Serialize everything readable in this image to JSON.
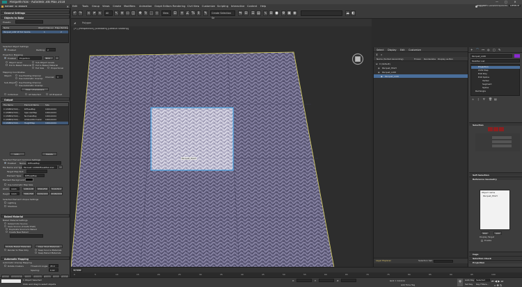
{
  "app": {
    "title": "ParquetF.max - Autodesk 3ds Max 2018",
    "window_controls": [
      "—",
      "□",
      "✕"
    ]
  },
  "menubar": {
    "items": [
      "Edit",
      "Tools",
      "Group",
      "Views",
      "Create",
      "Modifiers",
      "Animation",
      "Graph Editors",
      "Rendering",
      "Civil View",
      "Customize",
      "Scripting",
      "Interactive",
      "Content",
      "Help"
    ],
    "user": "Asggatm Co...",
    "workspace_label": "Workspaces:",
    "workspace": "Default"
  },
  "toolbar": {
    "view_select": "View",
    "selection_set": "Create Selection Se",
    "filter": "All",
    "icons": [
      "undo-icon",
      "redo-icon",
      "link-icon",
      "unlink-icon",
      "bind-icon",
      "select-icon",
      "select-by-name-icon",
      "region-icon",
      "window-crossing-icon",
      "move-icon",
      "rotate-icon",
      "scale-icon",
      "placement-icon",
      "pivot-icon",
      "snap-icon",
      "angle-snap-icon",
      "percent-snap-icon",
      "spinner-snap-icon",
      "edit-named-sets-icon",
      "mirror-icon",
      "align-icon",
      "layer-explorer-icon",
      "toggle-ribbon-icon",
      "curve-editor-icon",
      "schematic-icon",
      "material-editor-icon",
      "render-setup-icon",
      "rendered-frame-icon",
      "render-icon"
    ]
  },
  "subbar": {
    "label": "Polygon"
  },
  "rtt": {
    "title": "Render To Texture",
    "rollouts": {
      "general": "General Settings",
      "objects": "Objects to Bake",
      "output": "Output",
      "baked_material": "Baked Material",
      "auto_map": "Automatic Mapping"
    },
    "preset_label": "Presets:",
    "objects_table": {
      "headers": [
        "Name",
        "Object Channel",
        "Edge Padding"
      ],
      "rows": [
        [
          "Parquet_LOW 1E 8.0 Vanilla",
          "1",
          "2"
        ]
      ]
    },
    "selected_obj_settings": "Selected Object Settings",
    "enabled": "Enabled",
    "padding_label": "Padding:",
    "padding_value": "2",
    "projection_mapping": "Projection Mapping",
    "projection_enabled": "Enabled",
    "projection_mod": "Projection",
    "pick_btn": "Pick...",
    "object_level": "Object Level",
    "sub_object_levels": "Sub-Object Levels",
    "put_to_baked": "Put to Baked Material",
    "put_to_baked2": "Put to Baked Material",
    "full_size": "Full Size",
    "proportional": "Proportional",
    "mapping_coords": "Mapping Coordinates",
    "object_label": "Object:",
    "use_auto_unwrap": "Use Automatic Unwrap",
    "use_existing": "Use Existing Channel",
    "sub_objects_label": "Sub-Objects:",
    "channel_label": "Channel:",
    "channel_value": "3",
    "clear_unwrapper": "Clear Unwrappers",
    "individual": "Individual",
    "all_selected": "All Selected",
    "all_prepared": "All Prepared",
    "output_table": {
      "headers": [
        "File Name",
        "Element Name",
        "Size"
      ],
      "rows": [
        [
          "C:\\USERS\\YOU\\...",
          "DiffuseMap",
          "1024x1024"
        ],
        [
          "C:\\USERS\\YOU\\...",
          "SpecularMap",
          "1024x1024"
        ],
        [
          "C:\\USERS\\YOU\\...",
          "NormalsMap",
          "1024x1024"
        ],
        [
          "C:\\USERS\\YOU\\...",
          "AmbientOcclusion",
          "1024x1024"
        ],
        [
          "C:\\USERS\\YOU\\...",
          "HeightMap",
          "1024x1024"
        ]
      ]
    },
    "add_btn": "Add...",
    "delete_btn": "Delete",
    "selected_element_common": "Selected Element Common Settings",
    "name_label": "Name:",
    "name_value": "DiffuseMap",
    "file_name_type": "File Name and Type:",
    "file_value": "Parquet_LOWDiffuseMap.png",
    "target_map_slot": "Target Map Slot:",
    "element_type": "Element Type:",
    "element_type_value": "DiffuseMap",
    "element_background": "Element Background:",
    "use_auto_map_size": "Use Automatic Map Size",
    "width_label": "Width:",
    "width_value": "1024",
    "height_label": "Height:",
    "height_value": "1024",
    "sizes": [
      "128x128",
      "256x256",
      "512x512",
      "768x768",
      "1024x1024",
      "2048x2048"
    ],
    "unique_settings": "Selected Element Unique Settings",
    "lighting": "Lighting",
    "shadows": "Shadows",
    "baked_material_settings": "Baked Material Settings",
    "output_into_source": "Output Into Source",
    "save_source": "Save Source (Create Shell)",
    "duplicate_source": "Duplicate Source to Baked",
    "create_new_baked": "Create New Baked",
    "update_baked": "Update Baked Materials",
    "clear_shell": "Clear Shell Materials",
    "render_to_files_only": "Render to Files Only",
    "keep_source": "Keep Source Materials",
    "keep_baked": "Keep Baked Materials",
    "auto_unwrap_mapping": "Automatic Unwrap Mapping",
    "threshold_label": "Threshold Angle:",
    "threshold_value": "45.0",
    "rotate_clusters": "Rotate Clusters",
    "spacing_label": "Spacing:",
    "spacing_value": "0.02",
    "bottom_btns": [
      "Render",
      "Unwrap Only",
      "Close",
      "Original",
      "Baked",
      "Views",
      "Render"
    ]
  },
  "viewport": {
    "label": "[+] [Perspective] [Standard] [Default Shading]",
    "preview_label": "Parquet_HIGH"
  },
  "scene": {
    "menu": [
      "Select",
      "Display",
      "Edit",
      "Customize"
    ],
    "headers": [
      "Name (Sorted Ascending)",
      "Frozen",
      "Renderable",
      "Display as Box"
    ],
    "rows": [
      {
        "name": "0 (default)",
        "level": 0
      },
      {
        "name": "Parquet_HIGH",
        "level": 1
      },
      {
        "name": "Parquet_LOW",
        "level": 1
      },
      {
        "name": "Parquet_LOW",
        "level": 2
      }
    ],
    "footer": "Layer Explorer",
    "selection_set_label": "Selection Set:"
  },
  "cmd": {
    "object_name": "Parquet_LOW",
    "modifier_list": "Modifier List",
    "stack": [
      "Projection",
      "UVW Map",
      "Edit Poly",
      "Edit Spline",
      "Vertex",
      "Segment",
      "Spline",
      "Rectangle"
    ],
    "rollouts": [
      "Selection",
      "Soft Selection",
      "Reference Geometry",
      "Cage",
      "Selection Check",
      "Projection"
    ],
    "ref_list": [
      "Object name",
      "Parquet_HIGH"
    ],
    "pick_btn": "Pick",
    "add_btn": "Add",
    "display_label": "Display Target",
    "enable_label": "Enable"
  },
  "timeline": {
    "ticks": [
      "0",
      "5",
      "10",
      "15",
      "20",
      "25",
      "30",
      "35",
      "40",
      "45",
      "50",
      "55",
      "60",
      "65",
      "70",
      "75",
      "80",
      "85",
      "90",
      "95",
      "100"
    ],
    "frame_counter": "0 / 100"
  },
  "status": {
    "selection": "1 Object Selected",
    "prompt": "Click and drag to select objects",
    "x_label": "X:",
    "y_label": "Y:",
    "z_label": "Z:",
    "grid": "Grid = 10.0cm",
    "add_time_tag": "Add Time Tag",
    "auto_key": "Auto Key",
    "selected": "Selected",
    "set_key": "Set Key",
    "key_filters": "Key Filters..."
  },
  "colors": {
    "selection_blue": "#4aa8e8",
    "plane_outline": "#d8d060",
    "brand": "#4a6e9a"
  }
}
